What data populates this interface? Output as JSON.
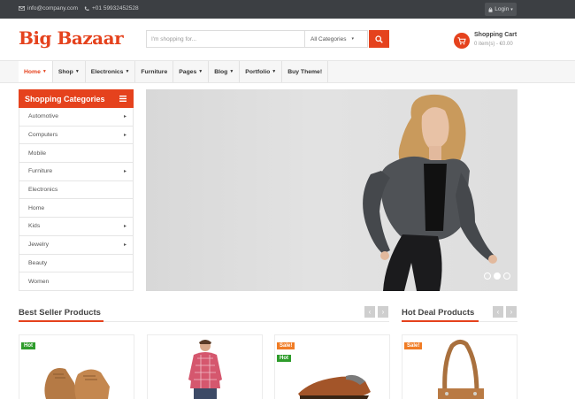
{
  "topbar": {
    "email": "info@company.com",
    "phone": "+01 59932452528",
    "login_label": "Login"
  },
  "header": {
    "logo_text": "Big Bazaar",
    "search_placeholder": "I'm shopping for...",
    "category_selected": "All Categories",
    "cart_title": "Shopping Cart",
    "cart_info": "0 item(s) - €0.00"
  },
  "nav": {
    "items": [
      {
        "label": "Home",
        "dropdown": true,
        "active": true
      },
      {
        "label": "Shop",
        "dropdown": true
      },
      {
        "label": "Electronics",
        "dropdown": true
      },
      {
        "label": "Furniture",
        "dropdown": false
      },
      {
        "label": "Pages",
        "dropdown": true
      },
      {
        "label": "Blog",
        "dropdown": true
      },
      {
        "label": "Portfolio",
        "dropdown": true
      },
      {
        "label": "Buy Theme!",
        "dropdown": false
      }
    ]
  },
  "sidebar": {
    "title": "Shopping Categories",
    "items": [
      {
        "label": "Automotive",
        "arrow": true
      },
      {
        "label": "Computers",
        "arrow": true
      },
      {
        "label": "Mobile",
        "arrow": false
      },
      {
        "label": "Furniture",
        "arrow": true
      },
      {
        "label": "Electronics",
        "arrow": false
      },
      {
        "label": "Home",
        "arrow": false
      },
      {
        "label": "Kids",
        "arrow": true
      },
      {
        "label": "Jewelry",
        "arrow": true
      },
      {
        "label": "Beauty",
        "arrow": false
      },
      {
        "label": "Women",
        "arrow": false
      }
    ]
  },
  "slider": {
    "active_slide": 2,
    "slide_count": 3
  },
  "sections": {
    "best_seller_title": "Best Seller Products",
    "hot_deal_title": "Hot Deal Products"
  },
  "products": {
    "card1": {
      "badges": [
        "Hot"
      ]
    },
    "card2": {
      "badges": []
    },
    "card3": {
      "badges": [
        "Sale!",
        "Hot"
      ]
    },
    "card4": {
      "badges": [
        "Sale!"
      ]
    }
  },
  "colors": {
    "accent": "#e5421d",
    "topbar_bg": "#3c3f43",
    "hot_badge": "#2e9c2b",
    "sale_badge": "#f07c25"
  }
}
